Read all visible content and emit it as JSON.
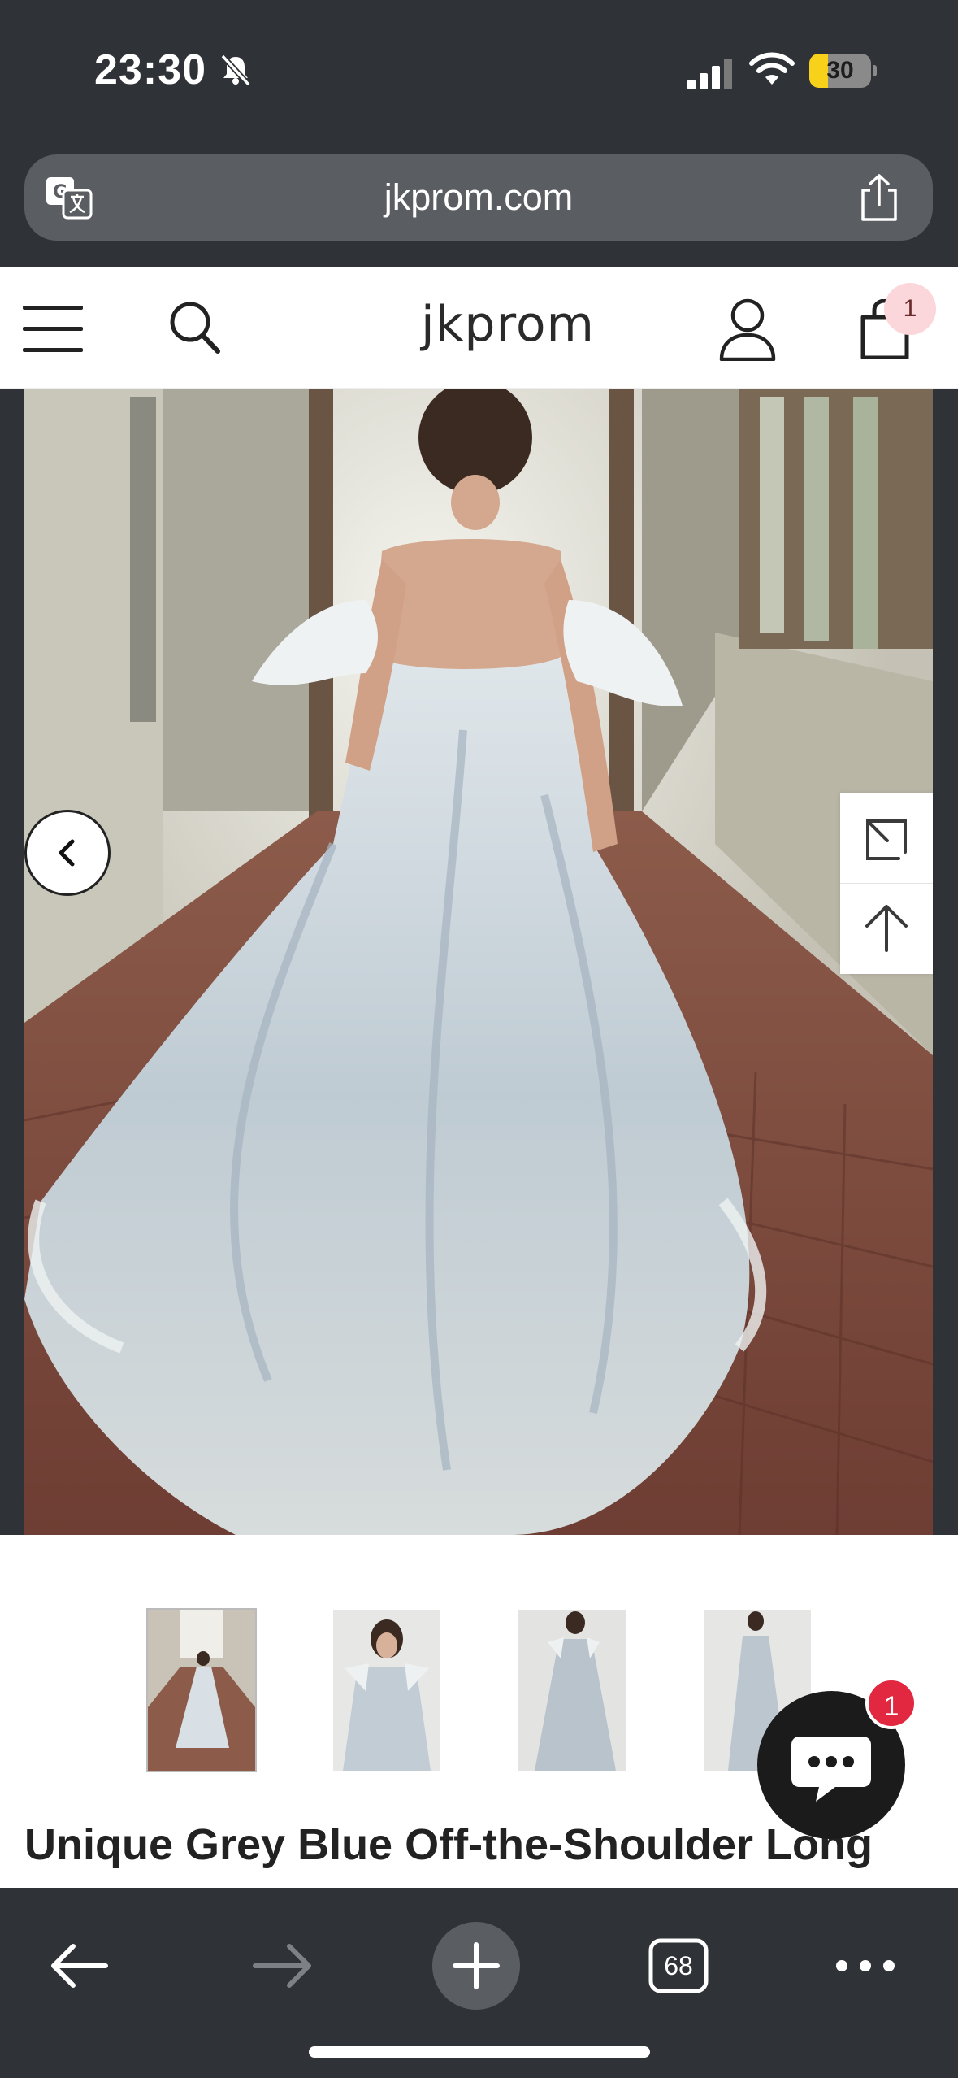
{
  "status_bar": {
    "time": "23:30",
    "battery_level": "30",
    "battery_fraction": 0.3,
    "icons": [
      "bell-slash-icon",
      "cellular-signal-icon",
      "wifi-icon",
      "battery-icon"
    ]
  },
  "browser": {
    "url": "jkprom.com",
    "tab_count": "68",
    "icons": [
      "translate-icon",
      "share-icon",
      "back-arrow-icon",
      "forward-arrow-icon",
      "new-tab-plus-icon",
      "tabs-icon",
      "more-dots-icon"
    ]
  },
  "site": {
    "logo": "jkprom",
    "cart_count": "1",
    "icons": [
      "menu-icon",
      "search-icon",
      "account-icon",
      "cart-bag-icon"
    ]
  },
  "product": {
    "title": "Unique Grey Blue Off-the-Shoulder Long",
    "thumbnail_count": 4,
    "active_thumbnail": 1
  },
  "chat": {
    "unread_count": "1"
  },
  "colors": {
    "chrome_dark": "#2f3236",
    "address_bar": "#5a5d61",
    "badge_red": "#e22741",
    "cart_badge_pink": "#fbd6da",
    "battery_yellow": "#f7d11a"
  }
}
